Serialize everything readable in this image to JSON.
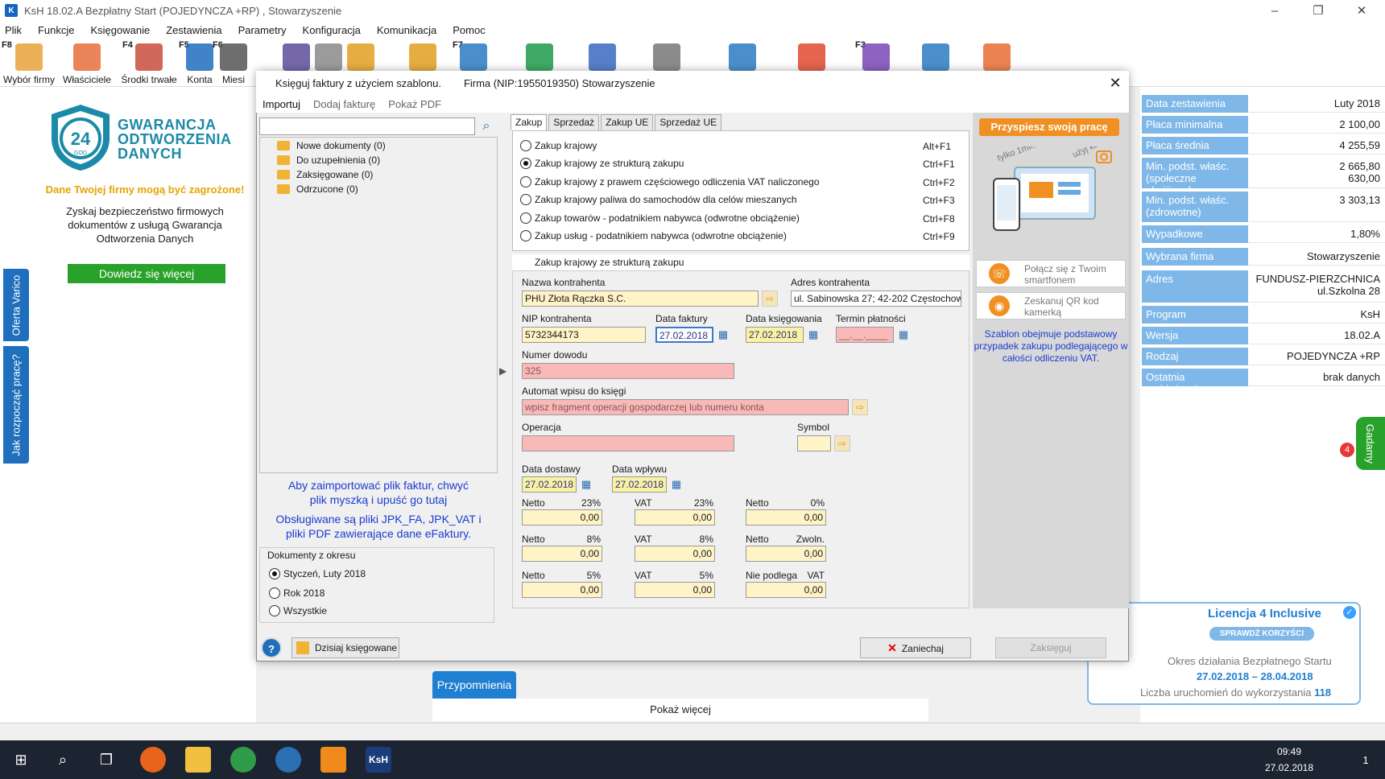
{
  "window": {
    "title": "KsH 18.02.A   Bezpłatny Start  (POJEDYNCZA +RP) , Stowarzyszenie",
    "app_icon_text": "K",
    "minimize": "–",
    "maximize": "❐",
    "close": "✕"
  },
  "menu": [
    "Plik",
    "Funkcje",
    "Księgowanie",
    "Zestawienia",
    "Parametry",
    "Konfiguracja",
    "Komunikacja",
    "Pomoc"
  ],
  "toolbar": [
    {
      "key": "F8",
      "label": "Wybór firmy",
      "icon": "house-icon",
      "color": "#e7a33b"
    },
    {
      "key": "",
      "label": "Właściciele",
      "icon": "people-icon",
      "color": "#e86f3c"
    },
    {
      "key": "F4",
      "label": "Środki trwałe",
      "icon": "building-car-icon",
      "color": "#c84d3d"
    },
    {
      "key": "F5",
      "label": "Konta",
      "icon": "accounts-icon",
      "color": "#1f6fbd"
    },
    {
      "key": "F6",
      "label": "Miesi",
      "icon": "calendar-icon",
      "color": "#555"
    },
    {
      "key": "",
      "label": "",
      "icon": "calculator-icon",
      "color": "#5c4d9a"
    },
    {
      "key": "",
      "label": "",
      "icon": "document-icon",
      "color": "#8a8a8a"
    },
    {
      "key": "",
      "label": "",
      "icon": "jpk-icon",
      "color": "#e2a021"
    },
    {
      "key": "",
      "label": "",
      "icon": "jpk-upload-icon",
      "color": "#e2a021"
    },
    {
      "key": "F7",
      "label": "",
      "icon": "transport-icon",
      "color": "#2a7bc3"
    },
    {
      "key": "",
      "label": "",
      "icon": "clock-icon",
      "color": "#1d9a4b"
    },
    {
      "key": "",
      "label": "",
      "icon": "line-chart-icon",
      "color": "#3a6ac1"
    },
    {
      "key": "",
      "label": "",
      "icon": "calc-grid-icon",
      "color": "#777"
    },
    {
      "key": "",
      "label": "",
      "icon": "spreadsheet-icon",
      "color": "#2a7bc3"
    },
    {
      "key": "",
      "label": "",
      "icon": "pie-chart-icon",
      "color": "#e0492e"
    },
    {
      "key": "F3",
      "label": "",
      "icon": "users-add-icon",
      "color": "#7a46b5"
    },
    {
      "key": "",
      "label": "",
      "icon": "gauge-icon",
      "color": "#2a7bc3"
    },
    {
      "key": "",
      "label": "",
      "icon": "chat-icon",
      "color": "#e66d32"
    }
  ],
  "left_banner": {
    "logo_number": "24",
    "logo_sub": "GOD",
    "title_lines": [
      "GWARANCJA",
      "ODTWORZENIA",
      "DANYCH"
    ],
    "warning": "Dane Twojej firmy mogą być zagrożone!",
    "description": "Zyskaj bezpieczeństwo firmowych dokumentów z usługą Gwarancja Odtworzenia Danych",
    "button": "Dowiedz się więcej",
    "side_tab_1": "Oferta Varico",
    "side_tab_2": "Jak rozpocząć pracę?"
  },
  "info_panel": [
    {
      "label": "Data zestawienia",
      "value": "Luty 2018"
    },
    {
      "label": "Płaca minimalna",
      "value": "2 100,00"
    },
    {
      "label": "Płaca średnia",
      "value": "4 255,59"
    },
    {
      "label": "Min. podst. właśc. (społeczne obniżone)",
      "value": "2 665,80\n630,00"
    },
    {
      "label": "Min. podst. właśc. (zdrowotne)",
      "value": "3 303,13"
    },
    {
      "label": "Wypadkowe",
      "value": "1,80%"
    },
    {
      "label": "Wybrana firma",
      "value": "Stowarzyszenie"
    },
    {
      "label": "Adres",
      "value": "FUNDUSZ-PIERZCHNICA\nul.Szkolna 28"
    },
    {
      "label": "Program",
      "value": "KsH"
    },
    {
      "label": "Wersja",
      "value": "18.02.A"
    },
    {
      "label": "Rodzaj",
      "value": "POJEDYNCZA +RP"
    },
    {
      "label": "Ostatnia archiwizacja",
      "value": "brak danych"
    }
  ],
  "chat_tab": {
    "label": "Gadamy",
    "badge": "4"
  },
  "licence": {
    "title": "Licencja 4 Inclusive",
    "check": "✓",
    "button": "SPRAWDŹ KORZYŚCI",
    "period_label": "Okres działania Bezpłatnego Startu",
    "period": "27.02.2018 – 28.04.2018",
    "count_label": "Liczba uruchomień do wykorzystania",
    "count": "118"
  },
  "reminders": {
    "tab": "Przypomnienia",
    "more": "Pokaż więcej"
  },
  "dialog": {
    "title": "Księguj faktury z użyciem szablonu.",
    "firm": "Firma (NIP:1955019350)  Stowarzyszenie",
    "close": "✕",
    "tabs": [
      "Importuj",
      "Dodaj fakturę",
      "Pokaż PDF"
    ],
    "search_placeholder": "",
    "search_icon": "⌕",
    "tree": [
      "Nowe dokumenty (0)",
      "Do uzupełnienia (0)",
      "Zaksięgowane (0)",
      "Odrzucone (0)"
    ],
    "import_hint": "Aby zaimportować plik faktur, chwyć plik myszką i upuść go tutaj",
    "import_hint2": "Obsługiwane są pliki JPK_FA, JPK_VAT i pliki PDF zawierające dane eFaktury.",
    "period_label": "Dokumenty z okresu",
    "period_options": [
      "Styczeń, Luty 2018",
      "Rok 2018",
      "Wszystkie"
    ],
    "period_selected": 0,
    "help_btn": "?",
    "today_btn": "Dzisiaj księgowane",
    "purchase_tabs": [
      "Zakup",
      "Sprzedaż",
      "Zakup UE",
      "Sprzedaż UE"
    ],
    "purchase_types": [
      {
        "label": "Zakup krajowy",
        "short": "Alt+F1"
      },
      {
        "label": "Zakup krajowy ze strukturą zakupu",
        "short": "Ctrl+F1"
      },
      {
        "label": "Zakup krajowy z prawem częściowego odliczenia VAT naliczonego",
        "short": "Ctrl+F2"
      },
      {
        "label": "Zakup krajowy paliwa do samochodów dla celów mieszanych",
        "short": "Ctrl+F3"
      },
      {
        "label": "Zakup towarów - podatnikiem nabywca (odwrotne obciążenie)",
        "short": "Ctrl+F8"
      },
      {
        "label": "Zakup usług - podatnikiem nabywca (odwrotne obciążenie)",
        "short": "Ctrl+F9"
      }
    ],
    "purchase_selected": 1,
    "selected_label": "Zakup krajowy ze strukturą zakupu",
    "form": {
      "contractor_name_label": "Nazwa kontrahenta",
      "contractor_name": "PHU Złota Rączka S.C.",
      "contractor_addr_label": "Adres kontrahenta",
      "contractor_addr": "ul. Sabinowska 27; 42-202 Częstochowa",
      "nip_label": "NIP kontrahenta",
      "nip": "5732344173",
      "invoice_date_label": "Data faktury",
      "invoice_date": "27.02.2018",
      "booking_date_label": "Data księgowania",
      "booking_date": "27.02.2018",
      "due_label": "Termin płatności",
      "due": "__.__.____",
      "doc_no_label": "Numer dowodu",
      "doc_no": "325",
      "auto_label": "Automat wpisu do księgi",
      "auto": "wpisz fragment operacji gospodarczej lub numeru konta",
      "operation_label": "Operacja",
      "operation": "",
      "symbol_label": "Symbol",
      "symbol": "",
      "delivery_label": "Data dostawy",
      "delivery": "27.02.2018",
      "receipt_label": "Data wpływu",
      "receipt": "27.02.2018",
      "amounts": [
        {
          "l1": "Netto",
          "r1": "23%",
          "v1": "0,00",
          "l2": "VAT",
          "r2": "23%",
          "v2": "0,00",
          "l3": "Netto",
          "r3": "0%",
          "v3": "0,00"
        },
        {
          "l1": "Netto",
          "r1": "8%",
          "v1": "0,00",
          "l2": "VAT",
          "r2": "8%",
          "v2": "0,00",
          "l3": "Netto",
          "r3": "Zwoln.",
          "v3": "0,00"
        },
        {
          "l1": "Netto",
          "r1": "5%",
          "v1": "0,00",
          "l2": "VAT",
          "r2": "5%",
          "v2": "0,00",
          "l3": "Nie podlega",
          "r3": "VAT",
          "v3": "0,00"
        }
      ]
    },
    "promo": {
      "header": "Przyspiesz swoją pracę",
      "img_text1": "tylko 1min",
      "img_text2": "użyj kamerki",
      "btn1": "Połącz się z Twoim smartfonem",
      "btn2": "Zeskanuj QR kod kamerką",
      "note": "Szablon obejmuje podstawowy przypadek zakupu podlegającego w całości odliczeniu VAT."
    },
    "cancel_btn": "Zaniechaj",
    "cancel_icon": "✕",
    "book_btn": "Zaksięguj"
  },
  "taskbar": {
    "time": "09:49",
    "date": "27.02.2018",
    "notif": "1",
    "apps": [
      "windows-icon",
      "search-icon",
      "task-view-icon",
      "firefox-icon",
      "explorer-icon",
      "chrome-icon",
      "thunderbird-icon",
      "app-icon",
      "ksh-icon"
    ],
    "ksh_label": "KsH"
  }
}
